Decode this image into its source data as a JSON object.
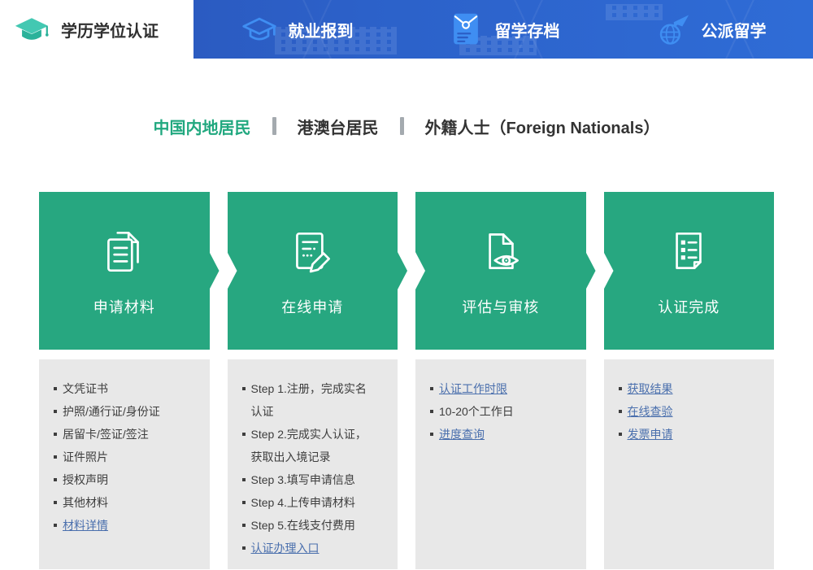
{
  "colors": {
    "nav_blue_start": "#2a54b8",
    "nav_blue_end": "#2f6cd6",
    "nav_icon_blue": "#3f8ef2",
    "brand_teal_light": "#43c8b2",
    "brand_teal_dark": "#2bb29a",
    "step_green": "#27a780",
    "active_text_green": "#21a87f",
    "info_gray": "#e8e8e8",
    "link_blue": "#4a6fad"
  },
  "header": {
    "tabs": [
      {
        "label": "学历学位认证",
        "icon": "graduation-cap-icon",
        "active": true
      },
      {
        "label": "就业报到",
        "icon": "graduation-cap-outline-icon",
        "active": false
      },
      {
        "label": "留学存档",
        "icon": "archive-file-icon",
        "active": false
      },
      {
        "label": "公派留学",
        "icon": "plane-globe-icon",
        "active": false
      }
    ]
  },
  "resident_tabs": [
    {
      "label": "中国内地居民",
      "active": true
    },
    {
      "label": "港澳台居民",
      "active": false
    },
    {
      "label": "外籍人士（Foreign Nationals）",
      "active": false
    }
  ],
  "steps": [
    {
      "id": "application-materials",
      "title": "申请材料",
      "icon": "documents-icon",
      "items": [
        {
          "text": "文凭证书",
          "link": false
        },
        {
          "text": "护照/通行证/身份证",
          "link": false
        },
        {
          "text": "居留卡/签证/签注",
          "link": false
        },
        {
          "text": "证件照片",
          "link": false
        },
        {
          "text": "授权声明",
          "link": false
        },
        {
          "text": "其他材料",
          "link": false
        },
        {
          "text": "材料详情",
          "link": true
        }
      ]
    },
    {
      "id": "online-application",
      "title": "在线申请",
      "icon": "edit-document-icon",
      "items": [
        {
          "text": "Step 1.注册，完成实名认证",
          "link": false
        },
        {
          "text": "Step 2.完成实人认证，获取出入境记录",
          "link": false
        },
        {
          "text": "Step 3.填写申请信息",
          "link": false
        },
        {
          "text": "Step 4.上传申请材料",
          "link": false
        },
        {
          "text": "Step 5.在线支付费用",
          "link": false
        },
        {
          "text": "认证办理入口",
          "link": true
        }
      ]
    },
    {
      "id": "evaluation-review",
      "title": "评估与审核",
      "icon": "document-eye-icon",
      "items": [
        {
          "text": "认证工作时限",
          "link": true
        },
        {
          "text": "10-20个工作日",
          "link": false
        },
        {
          "text": "进度查询",
          "link": true
        }
      ]
    },
    {
      "id": "certification-complete",
      "title": "认证完成",
      "icon": "checklist-document-icon",
      "items": [
        {
          "text": "获取结果",
          "link": true
        },
        {
          "text": "在线查验",
          "link": true
        },
        {
          "text": "发票申请",
          "link": true
        }
      ]
    }
  ]
}
